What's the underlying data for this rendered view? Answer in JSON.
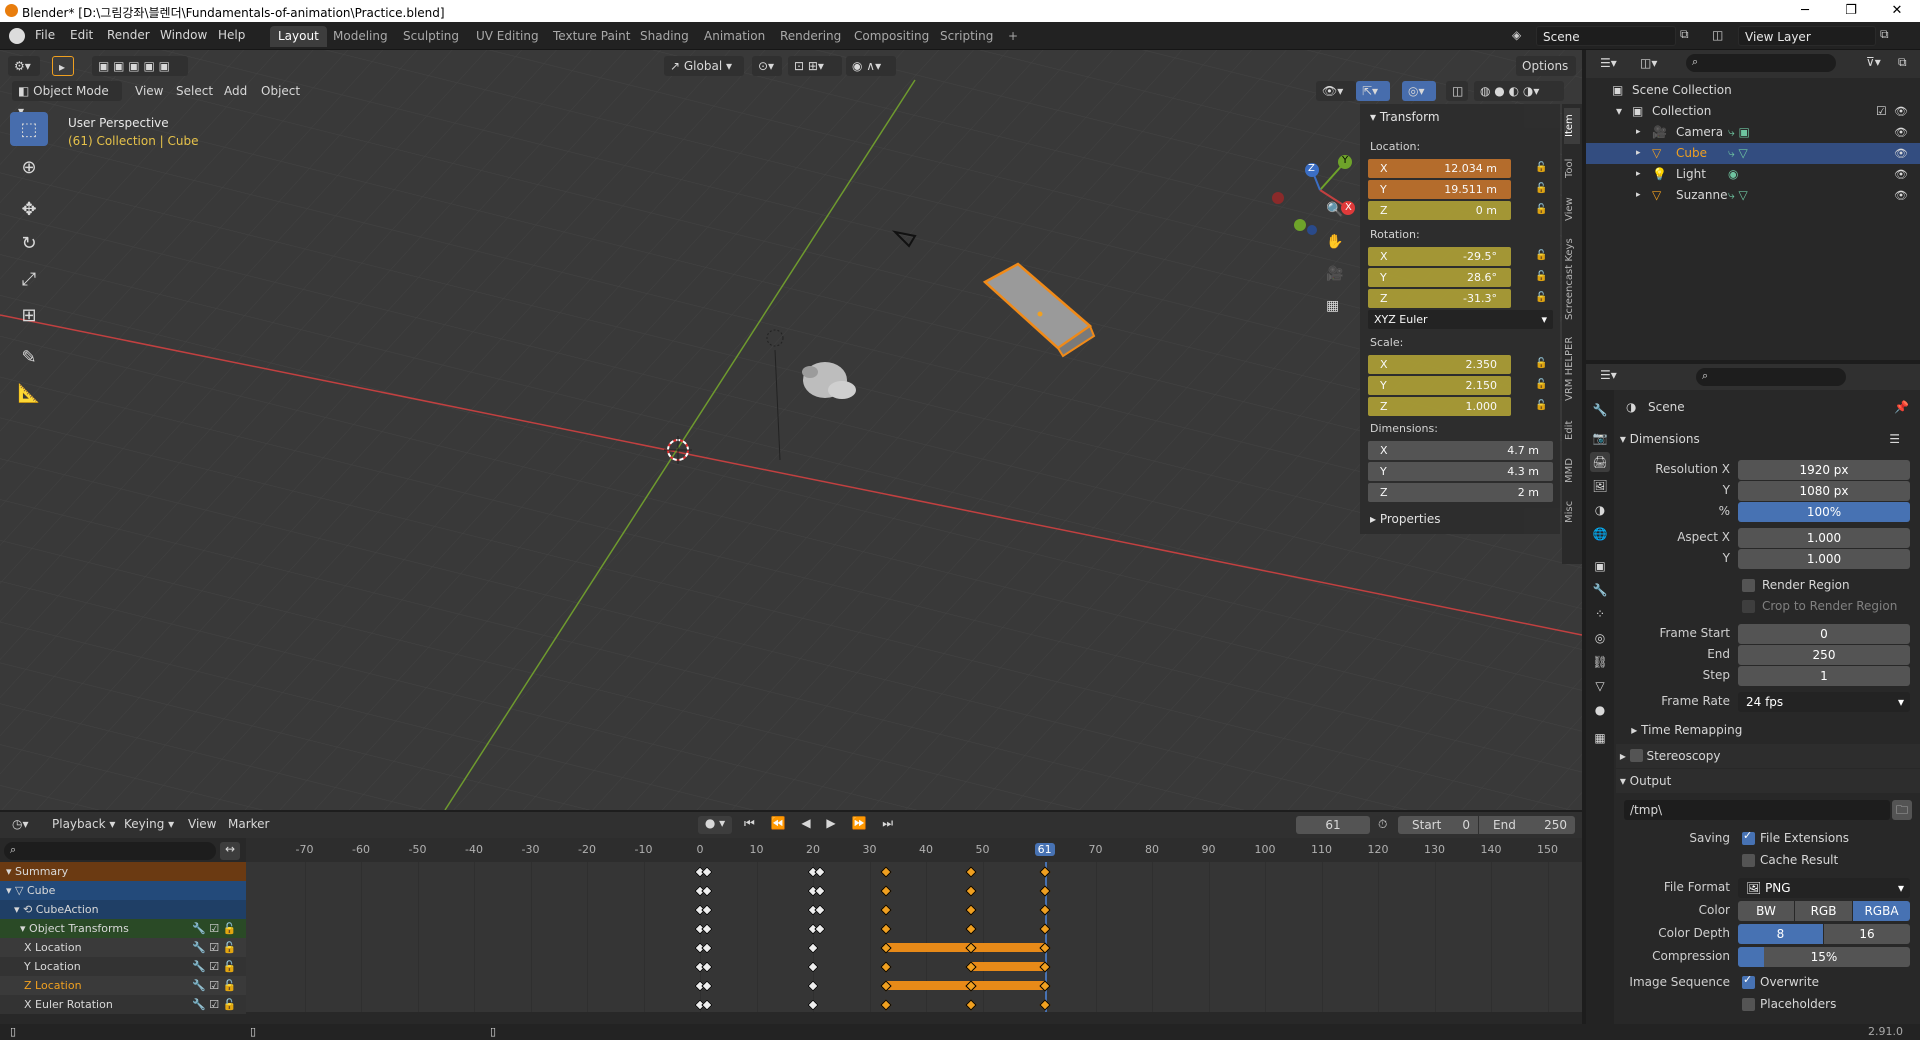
{
  "os_title": "Blender* [D:\\그림강좌\\블렌더\\Fundamentals-of-animation\\Practice.blend]",
  "menus": [
    "File",
    "Edit",
    "Render",
    "Window",
    "Help"
  ],
  "workspaces": [
    "Layout",
    "Modeling",
    "Sculpting",
    "UV Editing",
    "Texture Paint",
    "Shading",
    "Animation",
    "Rendering",
    "Compositing",
    "Scripting",
    "+"
  ],
  "active_workspace": "Layout",
  "scene_field": "Scene",
  "view_layer_field": "View Layer",
  "viewport": {
    "orientation": "Global",
    "options": "Options",
    "mode": "Object Mode",
    "menus": [
      "View",
      "Select",
      "Add",
      "Object"
    ],
    "overlay_title": "User Perspective",
    "overlay_sub": "(61) Collection | Cube",
    "gizmo": {
      "x": "X",
      "y": "Y",
      "z": "Z"
    }
  },
  "npanel": {
    "transform": "Transform",
    "location_label": "Location:",
    "location": [
      {
        "axis": "X",
        "value": "12.034 m"
      },
      {
        "axis": "Y",
        "value": "19.511 m"
      },
      {
        "axis": "Z",
        "value": "0 m"
      }
    ],
    "rotation_label": "Rotation:",
    "rotation": [
      {
        "axis": "X",
        "value": "-29.5°"
      },
      {
        "axis": "Y",
        "value": "28.6°"
      },
      {
        "axis": "Z",
        "value": "-31.3°"
      }
    ],
    "rotation_mode": "XYZ Euler",
    "scale_label": "Scale:",
    "scale": [
      {
        "axis": "X",
        "value": "2.350"
      },
      {
        "axis": "Y",
        "value": "2.150"
      },
      {
        "axis": "Z",
        "value": "1.000"
      }
    ],
    "dimensions_label": "Dimensions:",
    "dimensions": [
      {
        "axis": "X",
        "value": "4.7 m"
      },
      {
        "axis": "Y",
        "value": "4.3 m"
      },
      {
        "axis": "Z",
        "value": "2 m"
      }
    ],
    "properties": "Properties",
    "tabs": [
      "Item",
      "Tool",
      "View",
      "Screencast Keys",
      "VRM HELPER",
      "Edit",
      "MMD",
      "Misc"
    ]
  },
  "outliner": {
    "scene_collection": "Scene Collection",
    "collection": "Collection",
    "items": [
      "Camera",
      "Cube",
      "Light",
      "Suzanne"
    ],
    "selected": "Cube"
  },
  "properties": {
    "scene": "Scene",
    "dimensions": "Dimensions",
    "res_x_label": "Resolution X",
    "res_x": "1920 px",
    "res_y_label": "Y",
    "res_y": "1080 px",
    "res_pct_label": "%",
    "res_pct": "100%",
    "aspect_x_label": "Aspect X",
    "aspect_x": "1.000",
    "aspect_y_label": "Y",
    "aspect_y": "1.000",
    "render_region": "Render Region",
    "crop_region": "Crop to Render Region",
    "frame_start_label": "Frame Start",
    "frame_start": "0",
    "end_label": "End",
    "end": "250",
    "step_label": "Step",
    "step": "1",
    "frame_rate_label": "Frame Rate",
    "frame_rate": "24 fps",
    "time_remapping": "Time Remapping",
    "stereoscopy": "Stereoscopy",
    "output": "Output",
    "output_path": "/tmp\\",
    "saving_label": "Saving",
    "file_extensions": "File Extensions",
    "cache_result": "Cache Result",
    "file_format_label": "File Format",
    "file_format": "PNG",
    "color_label": "Color",
    "color_options": [
      "BW",
      "RGB",
      "RGBA"
    ],
    "color_depth_label": "Color Depth",
    "color_depth_options": [
      "8",
      "16"
    ],
    "compression_label": "Compression",
    "compression": "15%",
    "compression_fraction": 0.15,
    "image_sequence_label": "Image Sequence",
    "overwrite": "Overwrite",
    "placeholders": "Placeholders"
  },
  "timeline": {
    "menus": [
      "Playback",
      "Keying",
      "View",
      "Marker"
    ],
    "current_frame": "61",
    "start_label": "Start",
    "start": "0",
    "end_label": "End",
    "end": "250",
    "ruler": [
      "-70",
      "-60",
      "-50",
      "-40",
      "-30",
      "-20",
      "-10",
      "0",
      "10",
      "20",
      "30",
      "40",
      "50",
      "61",
      "70",
      "80",
      "90",
      "100",
      "110",
      "120",
      "130",
      "140",
      "150"
    ],
    "channels": [
      "Summary",
      "Cube",
      "CubeAction",
      "Object Transforms",
      "X Location",
      "Y Location",
      "Z Location",
      "X Euler Rotation"
    ]
  },
  "version": "2.91.0"
}
